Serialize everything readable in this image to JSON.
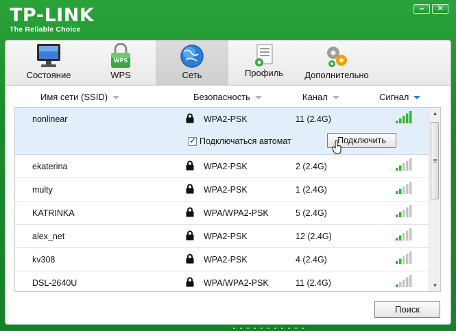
{
  "brand": {
    "name": "TP-LINK",
    "tagline": "The Reliable Choice"
  },
  "window_controls": {
    "minimize": "–",
    "close": "✕"
  },
  "tabs": [
    {
      "label": "Состояние",
      "icon": "monitor-icon",
      "active": false
    },
    {
      "label": "WPS",
      "icon": "wps-lock-icon",
      "active": false
    },
    {
      "label": "Сеть",
      "icon": "globe-icon",
      "active": true
    },
    {
      "label": "Профиль",
      "icon": "document-icon",
      "active": false
    },
    {
      "label": "Дополнительно",
      "icon": "gears-icon",
      "active": false
    }
  ],
  "columns": {
    "ssid": "Имя сети (SSID)",
    "security": "Безопасность",
    "channel": "Канал",
    "signal": "Сигнал"
  },
  "networks": [
    {
      "ssid": "nonlinear",
      "security": "WPA2-PSK",
      "channel": "11 (2.4G)",
      "signal_bars": 5
    },
    {
      "ssid": "ekaterina",
      "security": "WPA2-PSK",
      "channel": "2 (2.4G)",
      "signal_bars": 2
    },
    {
      "ssid": "multy",
      "security": "WPA2-PSK",
      "channel": "1 (2.4G)",
      "signal_bars": 2
    },
    {
      "ssid": "KATRINKA",
      "security": "WPA/WPA2-PSK",
      "channel": "5 (2.4G)",
      "signal_bars": 2
    },
    {
      "ssid": "alex_net",
      "security": "WPA2-PSK",
      "channel": "12 (2.4G)",
      "signal_bars": 2
    },
    {
      "ssid": "kv308",
      "security": "WPA2-PSK",
      "channel": "4 (2.4G)",
      "signal_bars": 2
    },
    {
      "ssid": "DSL-2640U",
      "security": "WPA/WPA2-PSK",
      "channel": "11 (2.4G)",
      "signal_bars": 1
    }
  ],
  "expanded": {
    "auto_connect_label": "Подключаться автомат",
    "auto_connect_checked": true,
    "connect_label": "Подключить"
  },
  "search_label": "Поиск",
  "colors": {
    "brand_green": "#1d8a2a",
    "signal_green": "#2eb82e",
    "signal_gray": "#c4c4c4",
    "selected_row": "#e2eef9",
    "sort_active": "#2a7fd6"
  }
}
